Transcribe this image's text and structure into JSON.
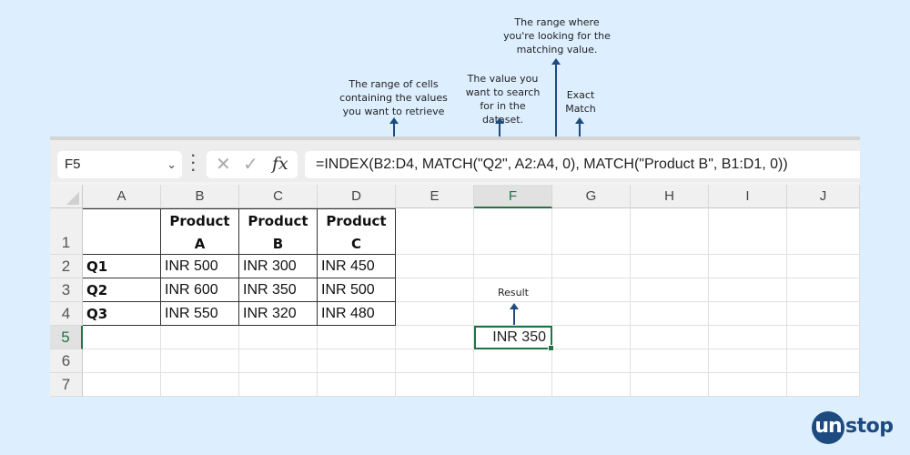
{
  "annotations": {
    "retrieve_range": "The range of cells containing the values you want to retrieve",
    "lookup_value": "The value you want to search for in the dataset.",
    "lookup_range": "The range where you're looking for the matching value.",
    "exact_match": "Exact Match",
    "result": "Result"
  },
  "formula_bar": {
    "name_box": "F5",
    "formula": "=INDEX(B2:D4, MATCH(\"Q2\", A2:A4, 0), MATCH(\"Product B\", B1:D1, 0))",
    "cancel_icon": "close-icon",
    "enter_icon": "check-icon",
    "fx_label": "fx"
  },
  "columns": [
    "A",
    "B",
    "C",
    "D",
    "E",
    "F",
    "G",
    "H",
    "I",
    "J"
  ],
  "rows": [
    "1",
    "2",
    "3",
    "4",
    "5",
    "6",
    "7"
  ],
  "table": {
    "headers": [
      "Product A",
      "Product B",
      "Product C"
    ],
    "header_line1": [
      "Product",
      "Product",
      "Product"
    ],
    "header_line2": [
      "A",
      "B",
      "C"
    ],
    "row_labels": [
      "Q1",
      "Q2",
      "Q3"
    ],
    "values": [
      [
        "INR 500",
        "INR 300",
        "INR 450"
      ],
      [
        "INR 600",
        "INR 350",
        "INR 500"
      ],
      [
        "INR 550",
        "INR 320",
        "INR 480"
      ]
    ]
  },
  "selected_cell": {
    "ref": "F5",
    "value": "INR 350"
  },
  "logo": {
    "prefix": "un",
    "suffix": "stop"
  },
  "colors": {
    "accent": "#1d4b80",
    "excel_green": "#217346",
    "background": "#ddeeff"
  }
}
